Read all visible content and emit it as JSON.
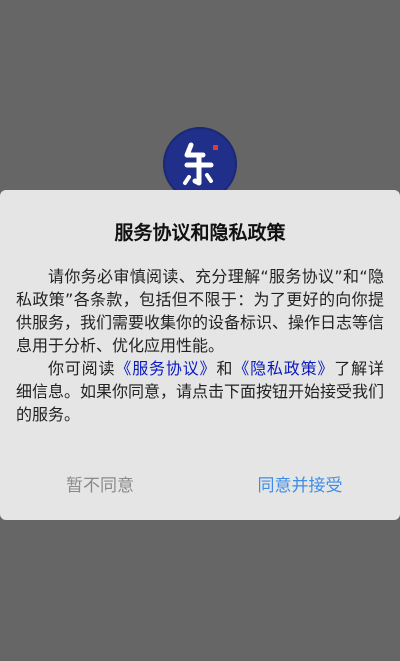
{
  "dialog": {
    "title": "服务协议和隐私政策",
    "para1": "请你务必审慎阅读、充分理解“服务协议”和“隐私政策”各条款，包括但不限于：为了更好的向你提供服务，我们需要收集你的设备标识、操作日志等信息用于分析、优化应用性能。",
    "para2_prefix": "你可阅读",
    "service_link": "《服务协议》",
    "para2_and": "和",
    "privacy_link": "《隐私政策》",
    "para2_suffix": "了解详细信息。如果你同意，请点击下面按钮开始接受我们的服务。",
    "decline_label": "暂不同意",
    "accept_label": "同意并接受"
  },
  "colors": {
    "overlay": "#666666",
    "dialog_bg": "#e5e5e5",
    "link": "#0a1bbd",
    "accept": "#3d8ee8",
    "decline": "#8a8a8a",
    "logo_bg": "#1f2f8a"
  },
  "icons": {
    "logo": "app-logo-icon"
  }
}
